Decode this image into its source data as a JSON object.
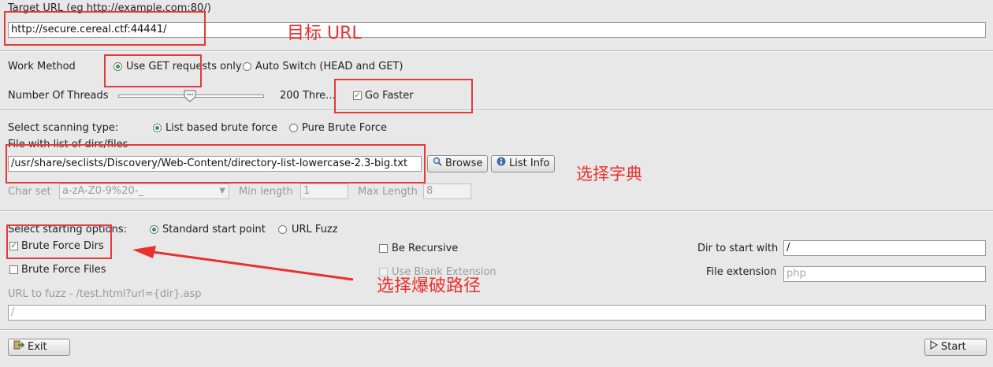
{
  "target": {
    "label": "Target URL (eg http://example.com:80/)",
    "value": "http://secure.cereal.ctf:44441/"
  },
  "work_method": {
    "label": "Work Method",
    "option_get": "Use GET requests only",
    "option_auto": "Auto Switch (HEAD and GET)",
    "selected": "get"
  },
  "threads": {
    "label": "Number Of Threads",
    "value_text": "200 Thre...",
    "go_faster_label": "Go Faster",
    "go_faster_checked": true,
    "slider_fraction": 0.49
  },
  "scan_type": {
    "label": "Select scanning type:",
    "option_list": "List based brute force",
    "option_pure": "Pure Brute Force",
    "selected": "list"
  },
  "wordlist": {
    "label": "File with list of dirs/files",
    "value": "/usr/share/seclists/Discovery/Web-Content/directory-list-lowercase-2.3-big.txt",
    "browse_label": "Browse",
    "list_info_label": "List Info"
  },
  "charset": {
    "label": "Char set",
    "value": "a-zA-Z0-9%20-_",
    "min_label": "Min length",
    "min_value": "1",
    "max_label": "Max Length",
    "max_value": "8"
  },
  "start_options": {
    "label": "Select starting options:",
    "option_standard": "Standard start point",
    "option_fuzz": "URL Fuzz",
    "selected": "standard"
  },
  "options": {
    "brute_dirs": "Brute Force Dirs",
    "brute_files": "Brute Force Files",
    "recursive": "Be Recursive",
    "blank_ext": "Use Blank Extension",
    "dir_start_label": "Dir to start with",
    "dir_start_value": "/",
    "file_ext_label": "File extension",
    "file_ext_placeholder": "php"
  },
  "fuzz": {
    "label": "URL to fuzz - /test.html?url={dir}.asp",
    "value": "/"
  },
  "buttons": {
    "exit": "Exit",
    "start": "Start"
  },
  "annotations": {
    "target": "目标 URL",
    "wordlist": "选择字典",
    "dirs": "选择爆破路径"
  },
  "colors": {
    "annotation": "#e8312f",
    "radio_selected": "#2f9e3f"
  }
}
